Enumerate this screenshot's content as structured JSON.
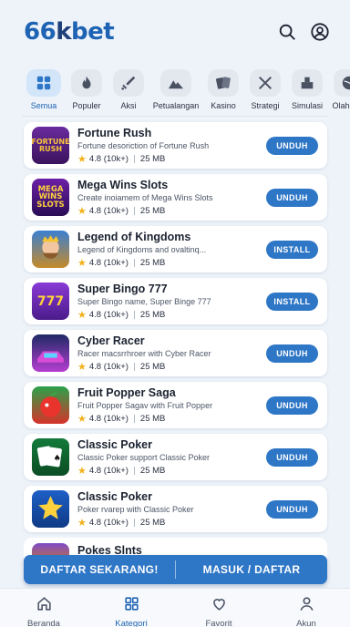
{
  "header": {
    "logo_main": "66",
    "logo_k": "k",
    "logo_end": "bet"
  },
  "categories": [
    {
      "label": "Semua",
      "icon": "grid-icon",
      "active": true
    },
    {
      "label": "Populer",
      "icon": "flame-icon"
    },
    {
      "label": "Aksi",
      "icon": "sword-icon"
    },
    {
      "label": "Petualangan",
      "icon": "mountain-icon"
    },
    {
      "label": "Kasino",
      "icon": "cards-icon"
    },
    {
      "label": "Strategi",
      "icon": "crossed-swords-icon"
    },
    {
      "label": "Simulasi",
      "icon": "building-icon"
    },
    {
      "label": "Olahraga",
      "icon": "ball-icon"
    }
  ],
  "games": [
    {
      "title": "Fortune Rush",
      "desc": "Fortune desoriction of Fortune Rush",
      "rating": "4.8 (10k+)",
      "size": "25 MB",
      "button": "UNDUH",
      "thumb_text": "FORTUNE RUSH"
    },
    {
      "title": "Mega Wins Slots",
      "desc": "Create inoiamem of Mega Wins Slots",
      "rating": "4.8 (10k+)",
      "size": "25 MB",
      "button": "UNDUH",
      "thumb_text": "MEGA WINS SLOTS"
    },
    {
      "title": "Legend of Kingdoms",
      "desc": "Legend of Kingdoms and ovaltinq...",
      "rating": "4.8 (10k+)",
      "size": "25 MB",
      "button": "INSTALL",
      "thumb_text": ""
    },
    {
      "title": "Super Bingo 777",
      "desc": "Super Bingo name, Super Binge 777",
      "rating": "4.8 (10k+)",
      "size": "25 MB",
      "button": "INSTALL",
      "thumb_text": "777"
    },
    {
      "title": "Cyber Racer",
      "desc": "Racer macsrrhroer with Cyber Racer",
      "rating": "4.8 (10k+)",
      "size": "25 MB",
      "button": "UNDUH",
      "thumb_text": ""
    },
    {
      "title": "Fruit Popper Saga",
      "desc": "Fruit Popper Sagav with Fruit Popper",
      "rating": "4.8 (10k+)",
      "size": "25 MB",
      "button": "UNDUH",
      "thumb_text": ""
    },
    {
      "title": "Classic Poker",
      "desc": "Classic Poker support Classic Poker",
      "rating": "4.8 (10k+)",
      "size": "25 MB",
      "button": "UNDUH",
      "thumb_text": ""
    },
    {
      "title": "Classic Poker",
      "desc": "Poker rvarep with Classic Poker",
      "rating": "4.8 (10k+)",
      "size": "25 MB",
      "button": "UNDUH",
      "thumb_text": ""
    }
  ],
  "partial_item": {
    "title": "Pokes Slnts"
  },
  "cta": {
    "left": "DAFTAR SEKARANG!",
    "right": "MASUK / DAFTAR"
  },
  "nav": [
    {
      "label": "Beranda",
      "icon": "home-icon"
    },
    {
      "label": "Kategori",
      "icon": "grid-icon",
      "active": true
    },
    {
      "label": "Favorit",
      "icon": "heart-icon"
    },
    {
      "label": "Akun",
      "icon": "person-icon"
    }
  ],
  "colors": {
    "primary": "#2e76c6",
    "logo": "#1e63b4",
    "star": "#f3b21b"
  }
}
